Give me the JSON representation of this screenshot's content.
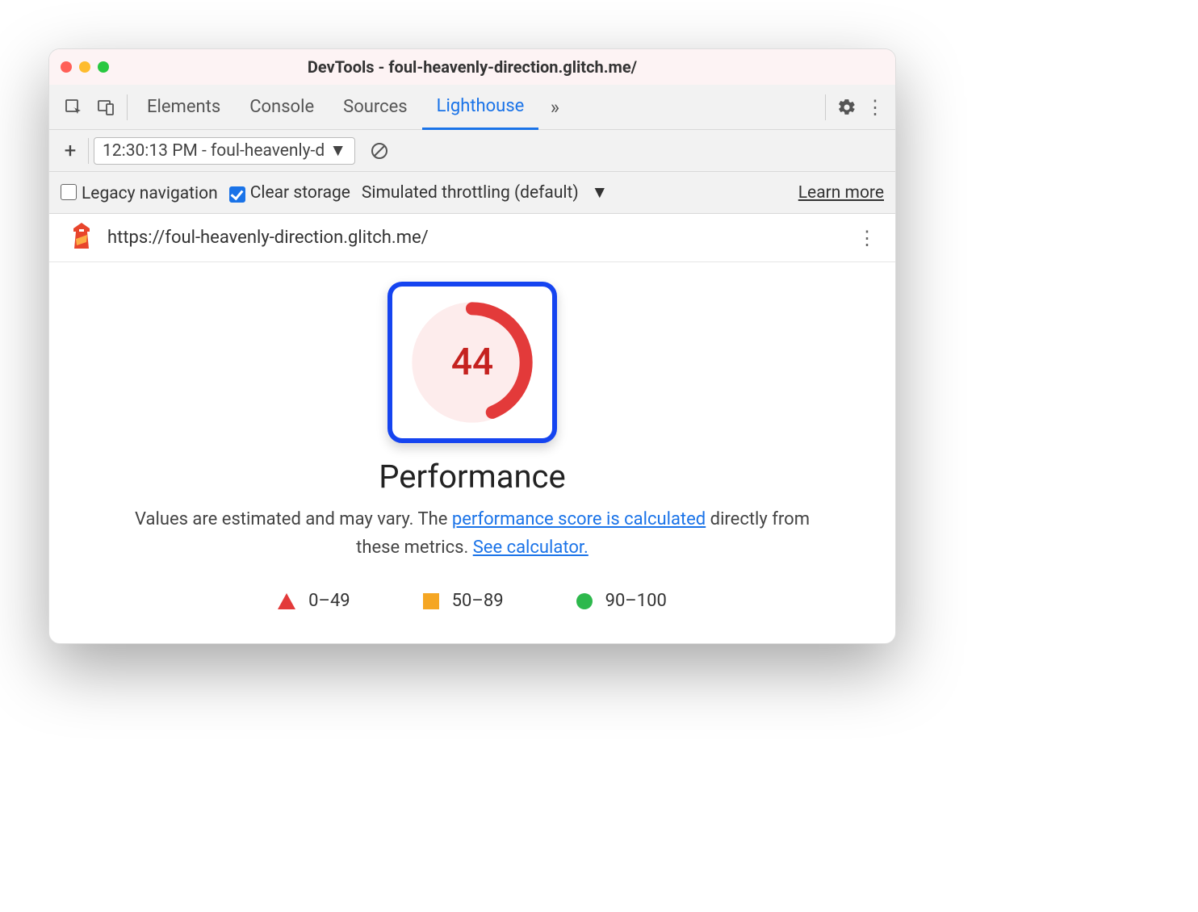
{
  "window": {
    "title": "DevTools - foul-heavenly-direction.glitch.me/"
  },
  "tabs": {
    "elements": "Elements",
    "console": "Console",
    "sources": "Sources",
    "lighthouse": "Lighthouse"
  },
  "subbar": {
    "run_label": "12:30:13 PM - foul-heavenly-d"
  },
  "options": {
    "legacy": "Legacy navigation",
    "clear": "Clear storage",
    "throttle": "Simulated throttling (default)",
    "learn": "Learn more"
  },
  "audit": {
    "url": "https://foul-heavenly-direction.glitch.me/"
  },
  "perf": {
    "score": "44",
    "title": "Performance",
    "desc_pre": "Values are estimated and may vary. The ",
    "link1": "performance score is calculated",
    "desc_mid": " directly from these metrics. ",
    "link2": "See calculator."
  },
  "legend": {
    "low": "0–49",
    "mid": "50–89",
    "high": "90–100"
  }
}
